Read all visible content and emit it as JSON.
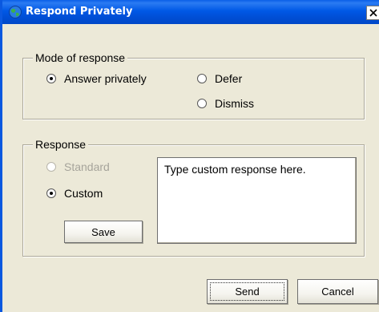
{
  "window": {
    "title": "Respond Privately"
  },
  "mode_group": {
    "label": "Mode of response",
    "options": [
      {
        "label": "Answer privately",
        "checked": true
      },
      {
        "label": "Defer",
        "checked": false
      },
      {
        "label": "Dismiss",
        "checked": false
      }
    ]
  },
  "response_group": {
    "label": "Response",
    "options": [
      {
        "label": "Standard",
        "checked": false,
        "disabled": true
      },
      {
        "label": "Custom",
        "checked": true,
        "disabled": false
      }
    ],
    "save_label": "Save",
    "text_value": "Type custom response here."
  },
  "footer": {
    "send_label": "Send",
    "cancel_label": "Cancel"
  },
  "icons": {
    "title_icon": "globe-icon",
    "close_icon": "close-icon"
  },
  "colors": {
    "titlebar": "#0058e6",
    "window_bg": "#ece9d8"
  }
}
